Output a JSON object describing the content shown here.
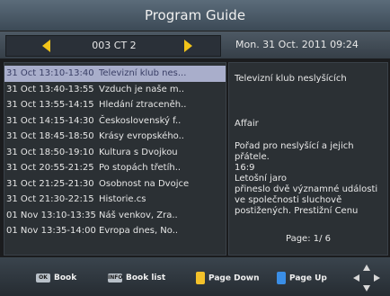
{
  "header": {
    "title": "Program Guide"
  },
  "channel": {
    "name": "003 CT 2",
    "datetime": "Mon. 31 Oct.  2011 09:24"
  },
  "programs": [
    {
      "time": "31 Oct 13:10-13:40",
      "name": "Televizní klub nes..."
    },
    {
      "time": "31 Oct 13:40-13:55",
      "name": "Vzduch je naše m.."
    },
    {
      "time": "31 Oct 13:55-14:15",
      "name": "Hledání ztraceněh.."
    },
    {
      "time": "31 Oct 14:15-14:30",
      "name": "Československý f.."
    },
    {
      "time": "31 Oct 18:45-18:50",
      "name": "Krásy evropského.."
    },
    {
      "time": "31 Oct 18:50-19:10",
      "name": "Kultura s Dvojkou"
    },
    {
      "time": "31 Oct 20:55-21:25",
      "name": "Po stopách třetíh.."
    },
    {
      "time": "31 Oct 21:25-21:30",
      "name": "Osobnost na Dvojce"
    },
    {
      "time": "31 Oct 21:30-22:15",
      "name": "Historie.cs"
    },
    {
      "time": "01 Nov 13:10-13:35",
      "name": "Náš venkov, Zra.."
    },
    {
      "time": "01 Nov 13:35-14:00",
      "name": "Evropa dnes, No.."
    }
  ],
  "detail": {
    "title": "Televizní klub neslyšících",
    "subtitle": "Affair",
    "lines": [
      "Pořad pro neslyšící a jejich",
      "přátele.",
      "16:9",
      "Letošní jaro",
      "přineslo dvě významné události",
      "ve společnosti sluchově",
      "postižených. Prestižní Cenu"
    ],
    "page": "Page:  1/ 6"
  },
  "footer": {
    "book": {
      "key": "OK",
      "label": "Book"
    },
    "book_list": {
      "key": "INFO",
      "label": "Book list"
    },
    "page_down": {
      "label": "Page Down"
    },
    "page_up": {
      "label": "Page Up"
    }
  },
  "colors": {
    "selected_row": "#a9aecb",
    "arrow": "#f2c419",
    "yellow_key": "#f3c12a",
    "blue_key": "#3a8ee6"
  }
}
